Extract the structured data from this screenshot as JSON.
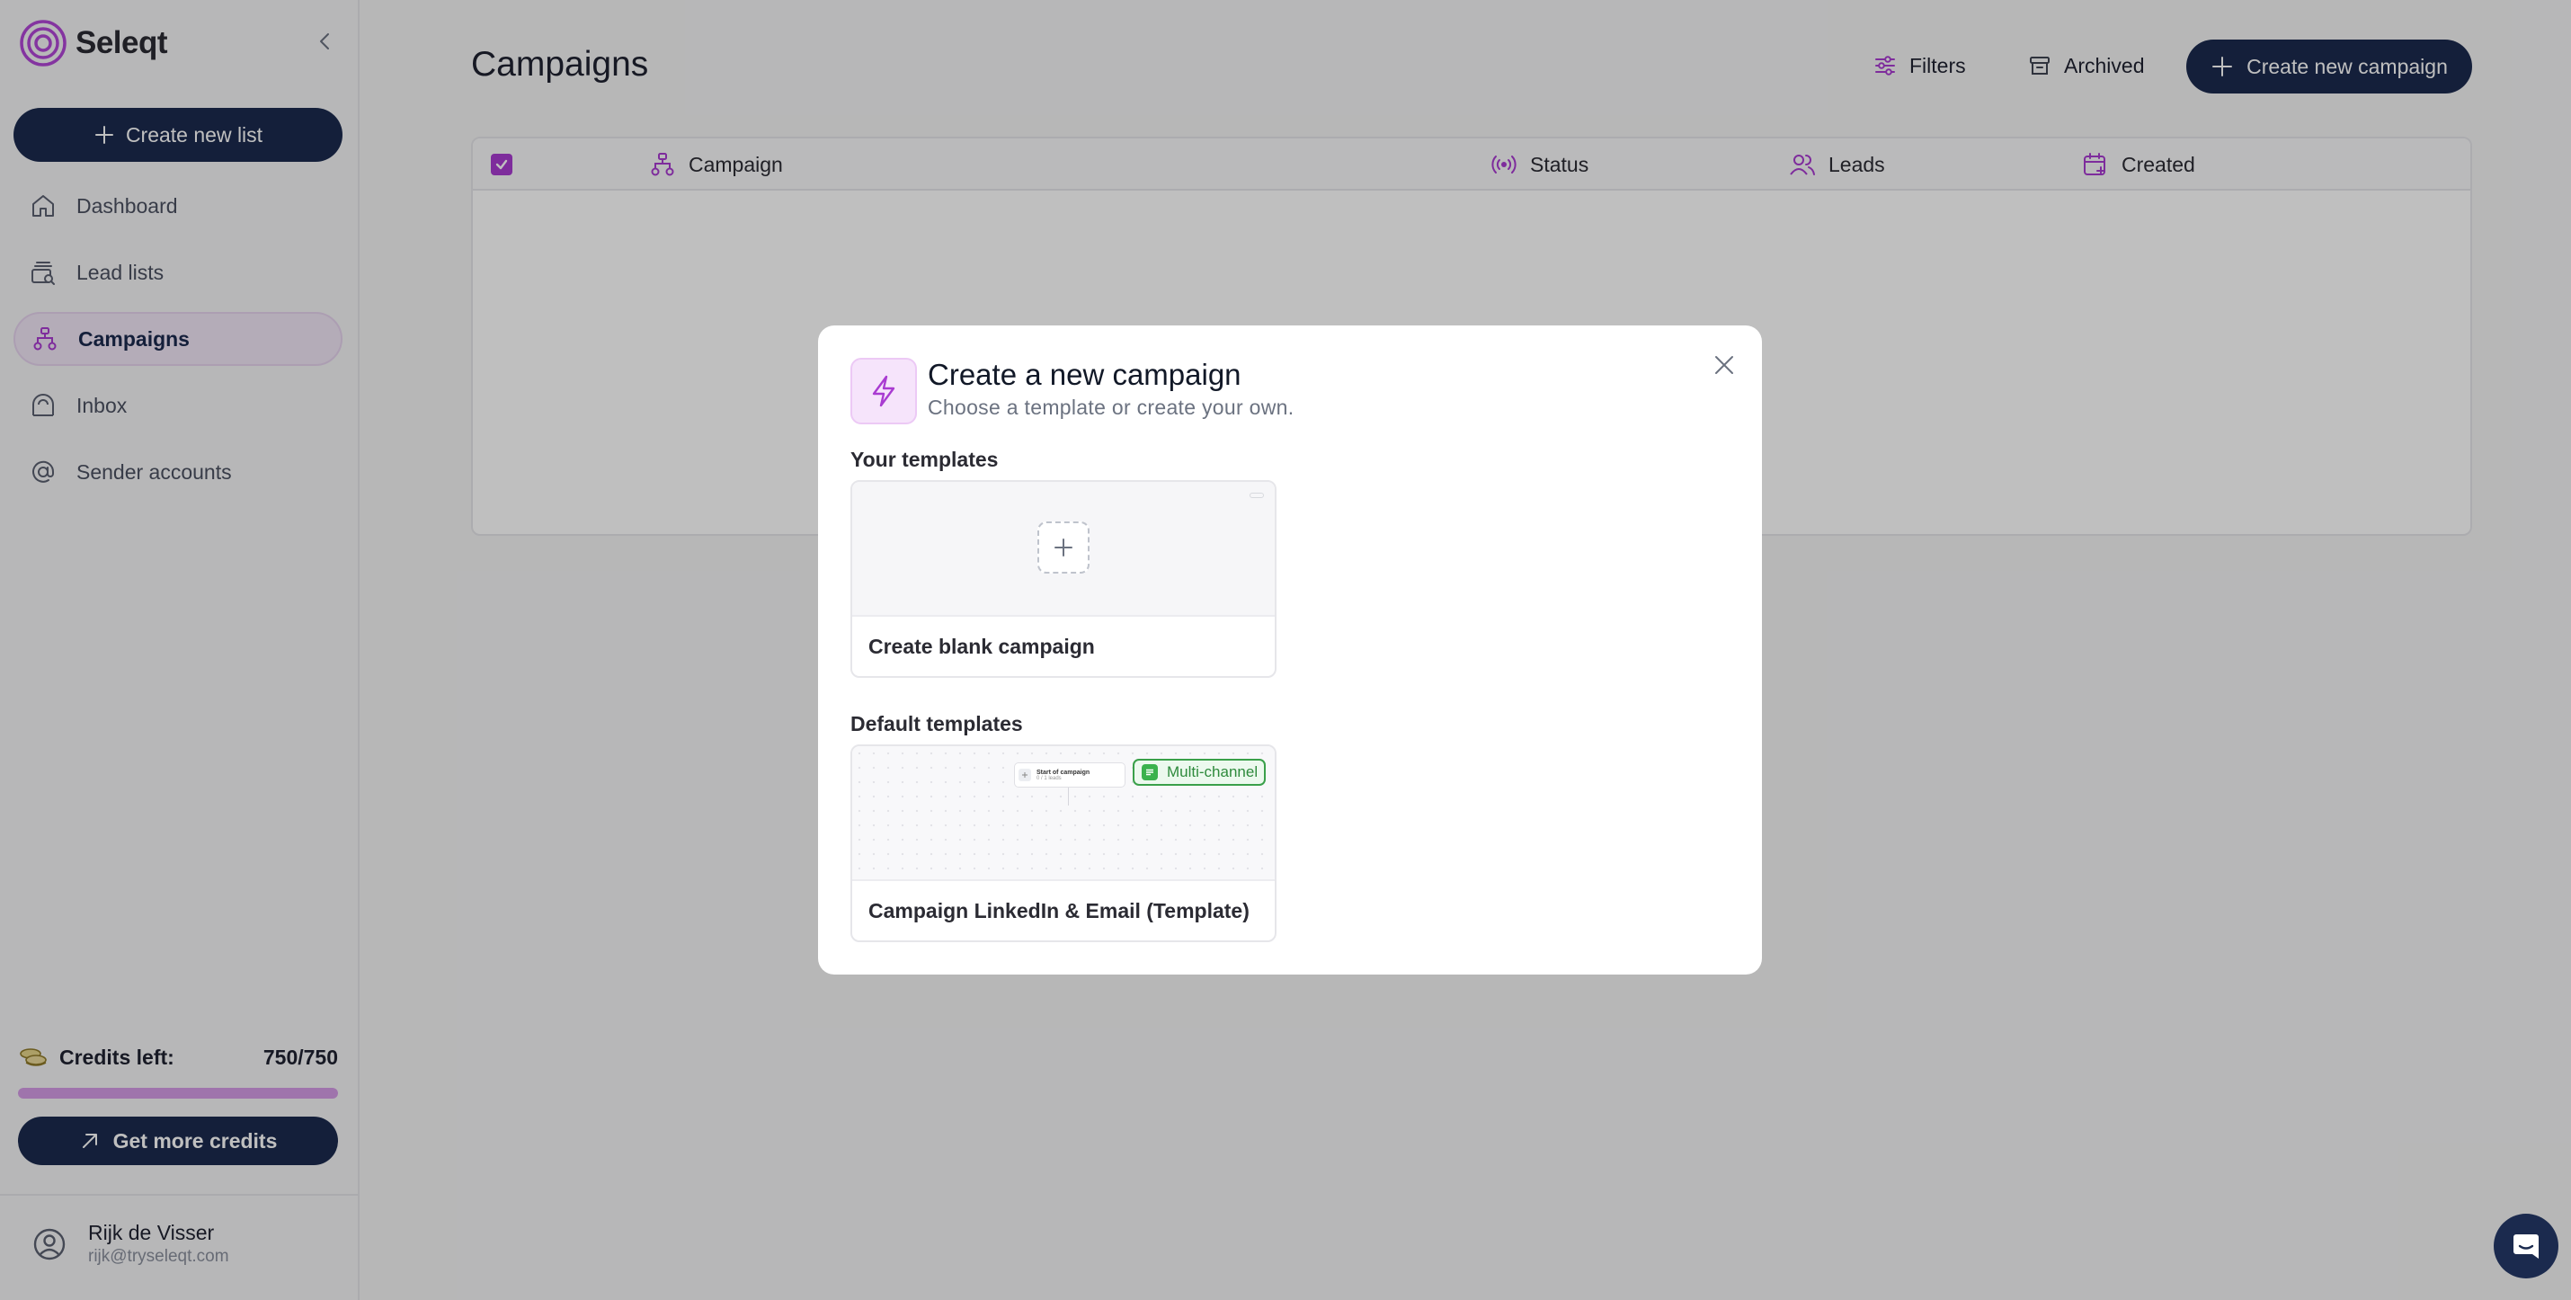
{
  "app": {
    "name": "Seleqt"
  },
  "sidebar": {
    "create_list_label": "Create new list",
    "items": [
      {
        "label": "Dashboard",
        "icon": "home-icon"
      },
      {
        "label": "Lead lists",
        "icon": "search-list-icon"
      },
      {
        "label": "Campaigns",
        "icon": "flow-icon",
        "active": true
      },
      {
        "label": "Inbox",
        "icon": "inbox-icon"
      },
      {
        "label": "Sender accounts",
        "icon": "at-icon"
      }
    ],
    "credits": {
      "label": "Credits left:",
      "value": "750/750",
      "fraction": 1.0
    },
    "get_more_label": "Get more credits",
    "user": {
      "name": "Rijk de Visser",
      "email": "rijk@tryseleqt.com"
    }
  },
  "main": {
    "title": "Campaigns",
    "filters_label": "Filters",
    "archived_label": "Archived",
    "create_campaign_label": "Create new campaign",
    "table": {
      "columns": [
        {
          "label": "Campaign",
          "icon": "flow-icon"
        },
        {
          "label": "Status",
          "icon": "broadcast-icon"
        },
        {
          "label": "Leads",
          "icon": "users-icon"
        },
        {
          "label": "Created",
          "icon": "calendar-plus-icon"
        }
      ],
      "all_selected": true
    }
  },
  "modal": {
    "title": "Create a new campaign",
    "subtitle": "Choose a template or create your own.",
    "your_templates_label": "Your templates",
    "blank_campaign_label": "Create blank campaign",
    "default_templates_label": "Default templates",
    "default_template": {
      "name": "Campaign LinkedIn & Email (Template)",
      "badge": "Multi-channel",
      "preview_node_title": "Start of campaign",
      "preview_node_sub": "0 / 1 leads"
    }
  },
  "colors": {
    "primary": "#1b2a4e",
    "accent": "#a93bd1",
    "badge_green": "#3aa04a"
  }
}
